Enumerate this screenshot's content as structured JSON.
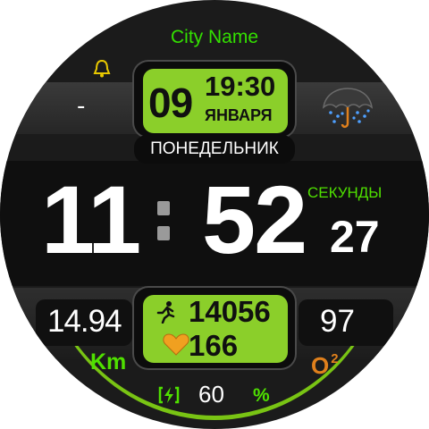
{
  "location": {
    "city": "City Name"
  },
  "date": {
    "day": "09",
    "time": "19:30",
    "month": "ЯНВАРЯ",
    "weekday": "ПОНЕДЕЛЬНИК"
  },
  "alarm": {
    "value": "-",
    "icon": "bell-icon"
  },
  "weather": {
    "icon": "umbrella-rain-icon"
  },
  "clock": {
    "hours": "11",
    "minutes": "52",
    "seconds_label": "СЕКУНДЫ",
    "seconds": "27"
  },
  "distance": {
    "value": "14.94",
    "unit": "Km"
  },
  "activity": {
    "steps": "14056",
    "steps_icon": "runner-icon",
    "heart_rate": "166",
    "heart_icon": "heart-icon"
  },
  "oxygen": {
    "value": "97",
    "label": "O",
    "label_sup": "2"
  },
  "battery": {
    "value": "60",
    "unit": "%",
    "icon": "battery-charging-icon"
  },
  "colors": {
    "accent": "#8bcf2a",
    "label_green": "#4fe000",
    "city_green": "#33e000",
    "bell_yellow": "#e8c800",
    "oxygen_orange": "#e0801c",
    "heart_orange": "#f0a020"
  }
}
